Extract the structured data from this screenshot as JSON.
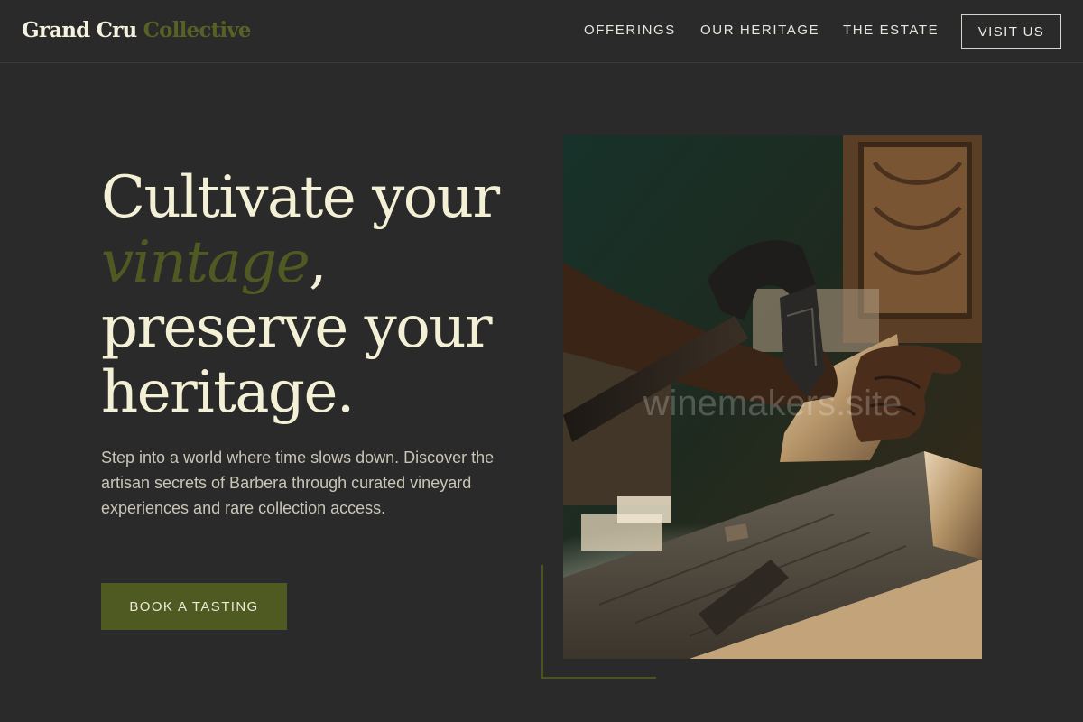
{
  "brand": {
    "name_part1": "Grand Cru",
    "name_part2": "Collective"
  },
  "nav": {
    "items": [
      {
        "label": "OFFERINGS"
      },
      {
        "label": "OUR HERITAGE"
      },
      {
        "label": "THE ESTATE"
      }
    ],
    "cta_label": "VISIT US"
  },
  "hero": {
    "title_line1": "Cultivate your",
    "title_accent": "vintage",
    "title_comma": ",",
    "title_line3": "preserve your",
    "title_line4": "heritage.",
    "subtitle": "Step into a world where time slows down. Discover the artisan secrets of Barbera through curated vineyard experiences and rare collection access.",
    "cta_label": "BOOK A TASTING"
  },
  "photo": {
    "watermark": "winemakers.site"
  },
  "colors": {
    "background": "#2a2a2a",
    "accent_olive": "#4f5a23",
    "title_cream": "#f3f0d6",
    "body_text": "#c9c6b6"
  }
}
